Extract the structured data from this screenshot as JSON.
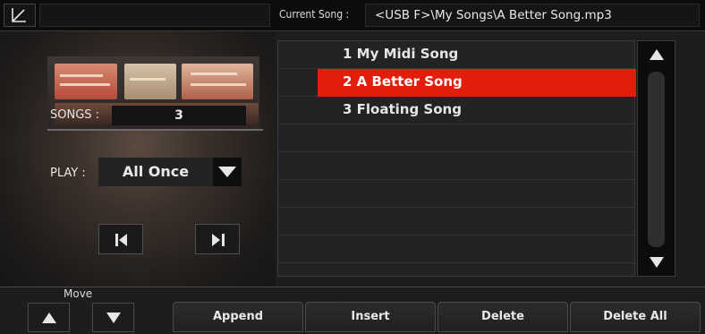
{
  "header": {
    "current_song_label": "Current Song :",
    "current_song_value": "<USB F>\\My Songs\\A Better Song.mp3"
  },
  "left_panel": {
    "songs_label": "SONGS :",
    "songs_count": "3",
    "play_label": "PLAY :",
    "play_mode": "All Once"
  },
  "playlist": {
    "items": [
      {
        "label": "1 My Midi Song"
      },
      {
        "label": "2 A Better Song"
      },
      {
        "label": "3 Floating Song"
      }
    ],
    "selected_index": 1
  },
  "bottom": {
    "move_label": "Move",
    "append_label": "Append",
    "insert_label": "Insert",
    "delete_label": "Delete",
    "delete_all_label": "Delete All"
  },
  "colors": {
    "selection": "#e21d0b",
    "background": "#1d1d1f"
  },
  "icons": [
    "back-arrow-icon",
    "dropdown-arrow-icon",
    "previous-track-icon",
    "next-track-icon",
    "scroll-up-icon",
    "scroll-down-icon",
    "move-up-icon",
    "move-down-icon"
  ]
}
